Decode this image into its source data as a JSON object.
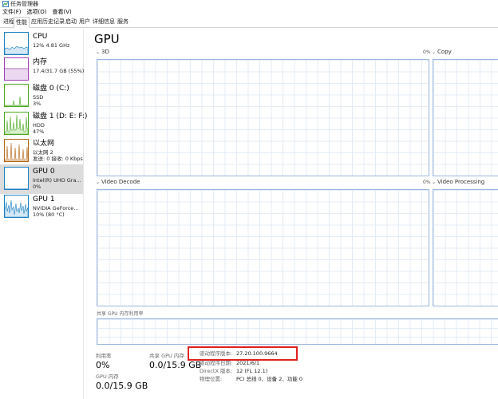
{
  "window": {
    "title": "任务管理器"
  },
  "menu": [
    "文件(F)",
    "选项(O)",
    "查看(V)"
  ],
  "tabs": [
    "进程",
    "性能",
    "应用历史记录",
    "启动",
    "用户",
    "详细信息",
    "服务"
  ],
  "active_tab": "性能",
  "sidebar": {
    "items": [
      {
        "name": "CPU",
        "sub1": "12% 4.81 GHz",
        "sub2": "",
        "color": "#1a7fc1"
      },
      {
        "name": "内存",
        "sub1": "17.4/31.7 GB (55%)",
        "sub2": "",
        "color": "#9b3eb1"
      },
      {
        "name": "磁盘 0 (C:)",
        "sub1": "SSD",
        "sub2": "3%",
        "color": "#4aa821"
      },
      {
        "name": "磁盘 1 (D: E: F:)",
        "sub1": "HDD",
        "sub2": "47%",
        "color": "#4aa821"
      },
      {
        "name": "以太网",
        "sub1": "以太网 2",
        "sub2": "发送: 0 接收: 0 Kbps",
        "color": "#b2661a"
      },
      {
        "name": "GPU 0",
        "sub1": "Intel(R) UHD Gra...",
        "sub2": "0%",
        "color": "#1a7fc1"
      },
      {
        "name": "GPU 1",
        "sub1": "NVIDIA GeForce...",
        "sub2": "10% (80 °C)",
        "color": "#1a7fc1"
      }
    ],
    "selected_index": 5
  },
  "main": {
    "title": "GPU",
    "graphs": [
      {
        "label": "3D",
        "pct": "0%"
      },
      {
        "label": "Copy",
        "pct": ""
      },
      {
        "label": "Video Decode",
        "pct": "0%"
      },
      {
        "label": "Video Processing",
        "pct": ""
      }
    ],
    "shared_memory_label": "共享 GPU 内存利用率",
    "stats": {
      "utilization_label": "利用率",
      "utilization_value": "0%",
      "shared_label": "共享 GPU 内存",
      "shared_value": "0.0/15.9 GB",
      "gpu_mem_label": "GPU 内存",
      "gpu_mem_value": "0.0/15.9 GB"
    },
    "details": [
      {
        "key": "驱动程序版本:",
        "value": "27.20.100.9664"
      },
      {
        "key": "驱动程序日期:",
        "value": "2021/6/1"
      },
      {
        "key": "DirectX 版本:",
        "value": "12 (FL 12.1)"
      },
      {
        "key": "物理位置:",
        "value": "PCI 总线 0、设备 2、功能 0"
      }
    ]
  }
}
